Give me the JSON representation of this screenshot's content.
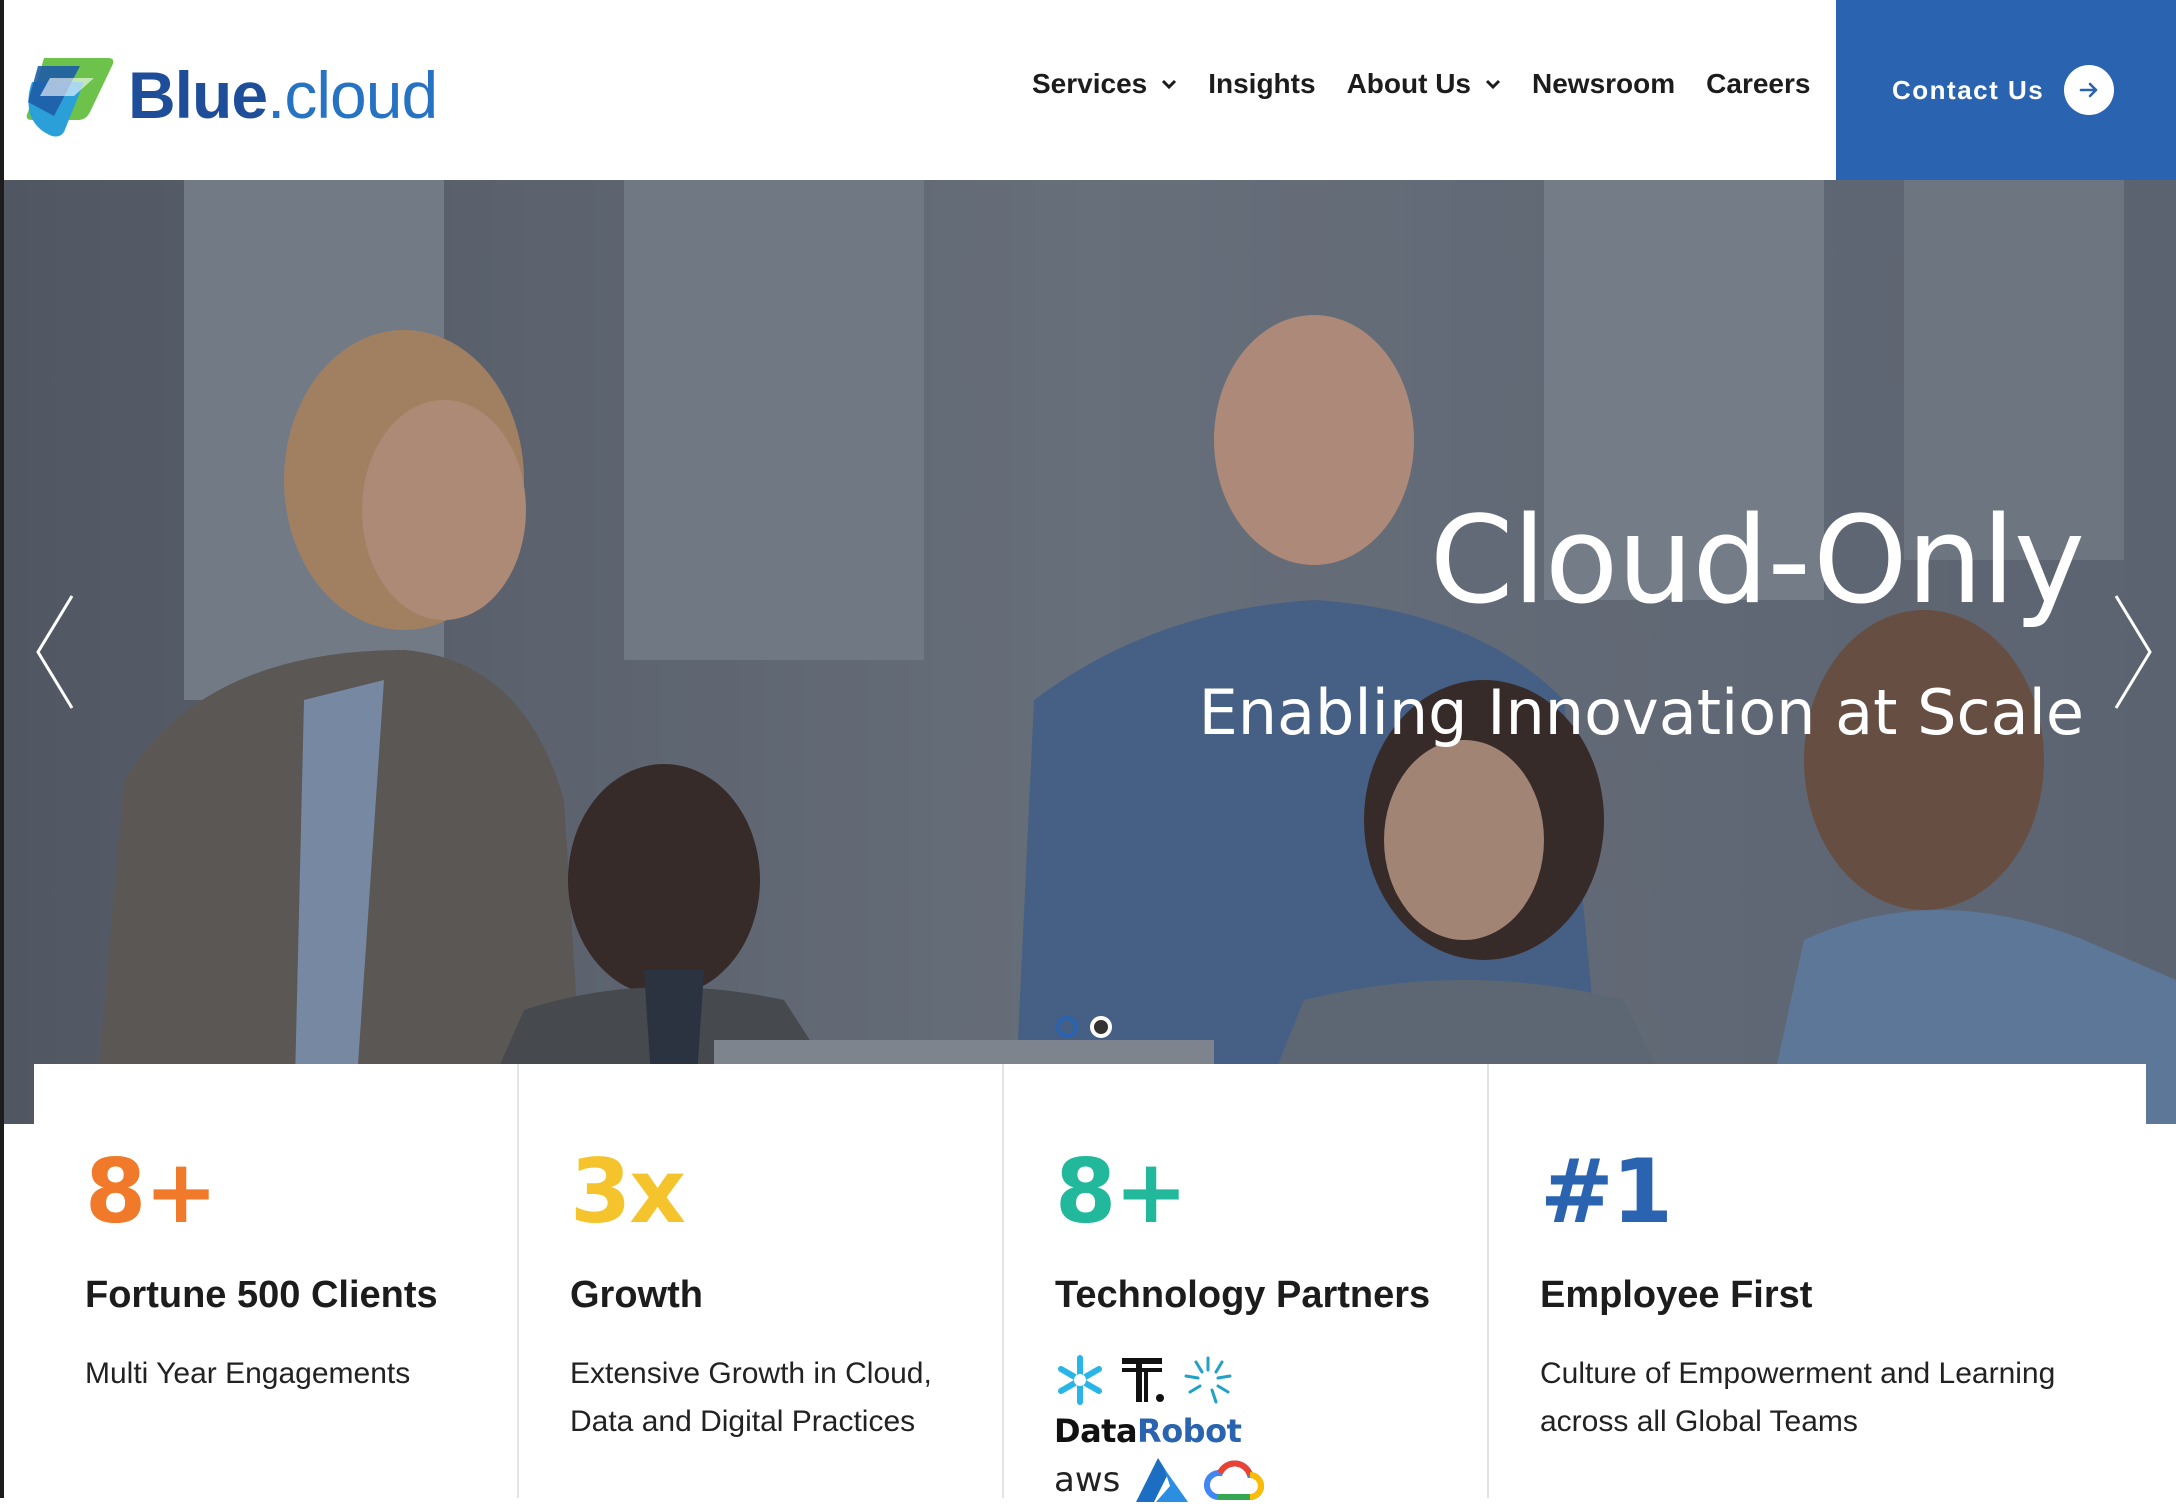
{
  "header": {
    "logo": {
      "brand": "Blue",
      "suffix": ".cloud"
    },
    "nav": [
      {
        "label": "Services",
        "has_dropdown": true
      },
      {
        "label": "Insights",
        "has_dropdown": false
      },
      {
        "label": "About Us",
        "has_dropdown": true
      },
      {
        "label": "Newsroom",
        "has_dropdown": false
      },
      {
        "label": "Careers",
        "has_dropdown": false
      }
    ],
    "contact_label": "Contact Us",
    "contact_icon": "arrow-right-icon"
  },
  "hero": {
    "title": "Cloud-Only",
    "subtitle": "Enabling Innovation at Scale",
    "prev_icon": "chevron-left-icon",
    "next_icon": "chevron-right-icon",
    "slides_total": 2,
    "active_slide": 1
  },
  "stats": [
    {
      "number": "8+",
      "color": "#f07a2a",
      "title": "Fortune 500 Clients",
      "description": "Multi Year Engagements"
    },
    {
      "number": "3x",
      "color": "#f5c42c",
      "title": "Growth",
      "description": "Extensive Growth in Cloud, Data and Digital Practices"
    },
    {
      "number": "8+",
      "color": "#21b89b",
      "title": "Technology Partners",
      "partners": [
        "snowflake-icon",
        "talend-icon",
        "databricks-burst-icon",
        "DataRobot",
        "aws",
        "azure-icon",
        "google-cloud-icon"
      ]
    },
    {
      "number": "#1",
      "color": "#2a64b0",
      "title": "Employee First",
      "description": "Culture of Empowerment and Learning across all Global Teams"
    }
  ],
  "colors": {
    "brand_blue": "#2a64b0",
    "logo_green": "#6cc24a"
  }
}
